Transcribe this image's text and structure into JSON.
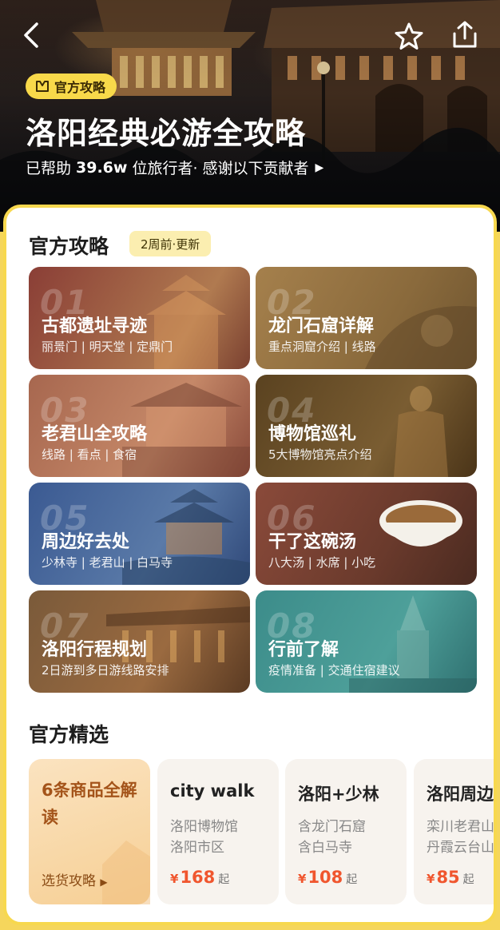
{
  "header": {
    "badge_label": "官方攻略",
    "title": "洛阳经典必游全攻略",
    "sub_prefix": "已帮助",
    "sub_count": "39.6w",
    "sub_suffix": "位旅行者· 感谢以下贡献者",
    "icons": [
      "back-icon",
      "star-icon",
      "share-icon",
      "triangle-right-icon",
      "tag-icon"
    ]
  },
  "official": {
    "title": "官方攻略",
    "update_label": "2周前·更新",
    "cards": [
      {
        "num": "01",
        "title": "古都遗址寻迹",
        "sub": "丽景门 | 明天堂 | 定鼎门",
        "color": "#7a4a3a"
      },
      {
        "num": "02",
        "title": "龙门石窟详解",
        "sub": "重点洞窟介绍 | 线路",
        "color": "#8b6a3c"
      },
      {
        "num": "03",
        "title": "老君山全攻略",
        "sub": "线路 | 看点 | 食宿",
        "color": "#9b5a44"
      },
      {
        "num": "04",
        "title": "博物馆巡礼",
        "sub": "5大博物馆亮点介绍",
        "color": "#6a5128"
      },
      {
        "num": "05",
        "title": "周边好去处",
        "sub": "少林寺 | 老君山 | 白马寺",
        "color": "#3e5a8a"
      },
      {
        "num": "06",
        "title": "干了这碗汤",
        "sub": "八大汤 | 水席 | 小吃",
        "color": "#7a4a3a"
      },
      {
        "num": "07",
        "title": "洛阳行程规划",
        "sub": "2日游到多日游线路安排",
        "color": "#7a5238"
      },
      {
        "num": "08",
        "title": "行前了解",
        "sub": "疫情准备 | 交通住宿建议",
        "color": "#3f8a8a"
      }
    ]
  },
  "selection": {
    "title": "官方精选",
    "first": {
      "title": "6条商品全解读",
      "guide": "选货攻略"
    },
    "products": [
      {
        "title": "city walk",
        "line1": "洛阳博物馆",
        "line2": "洛阳市区",
        "yen": "¥",
        "price": "168",
        "qi": "起"
      },
      {
        "title": "洛阳+少林",
        "line1": "含龙门石窟",
        "line2": "含白马寺",
        "yen": "¥",
        "price": "108",
        "qi": "起"
      },
      {
        "title": "洛阳周边",
        "line1": "栾川老君山",
        "line2": "丹霞云台山",
        "yen": "¥",
        "price": "85",
        "qi": "起"
      }
    ]
  },
  "colors": {
    "accent": "#f7d84e",
    "price": "#f0562e",
    "badge": "#f8d94a"
  }
}
